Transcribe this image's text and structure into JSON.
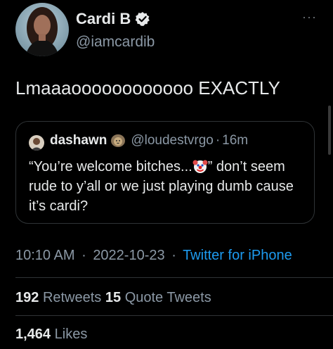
{
  "author": {
    "display_name": "Cardi B",
    "handle": "@iamcardib",
    "verified_icon": "verified-badge-icon"
  },
  "more_label": "···",
  "tweet": {
    "text": "Lmaaaoooooooooooo EXACTLY"
  },
  "quoted_tweet": {
    "display_name": "dashawn",
    "badge_icon": "lion-emoji-icon",
    "handle": "@loudestvrgo",
    "separator": "·",
    "time": "16m",
    "text_before_emoji": "“You’re welcome bitches...",
    "emoji_icon": "clown-face-icon",
    "text_after_emoji": "” don’t seem rude to y’all or we just playing dumb cause it’s cardi?"
  },
  "meta": {
    "time": "10:10 AM",
    "dot": "·",
    "date": "2022-10-23",
    "dot2": "·",
    "source": "Twitter for iPhone"
  },
  "stats": {
    "retweets_count": "192",
    "retweets_label": "Retweets",
    "quotes_count": "15",
    "quotes_label": "Quote Tweets",
    "likes_count": "1,464",
    "likes_label": "Likes"
  },
  "colors": {
    "background": "#000000",
    "primary_text": "#e7e9ea",
    "secondary_text": "#8b98a5",
    "link": "#1d9bf0",
    "border": "#2f3336"
  }
}
